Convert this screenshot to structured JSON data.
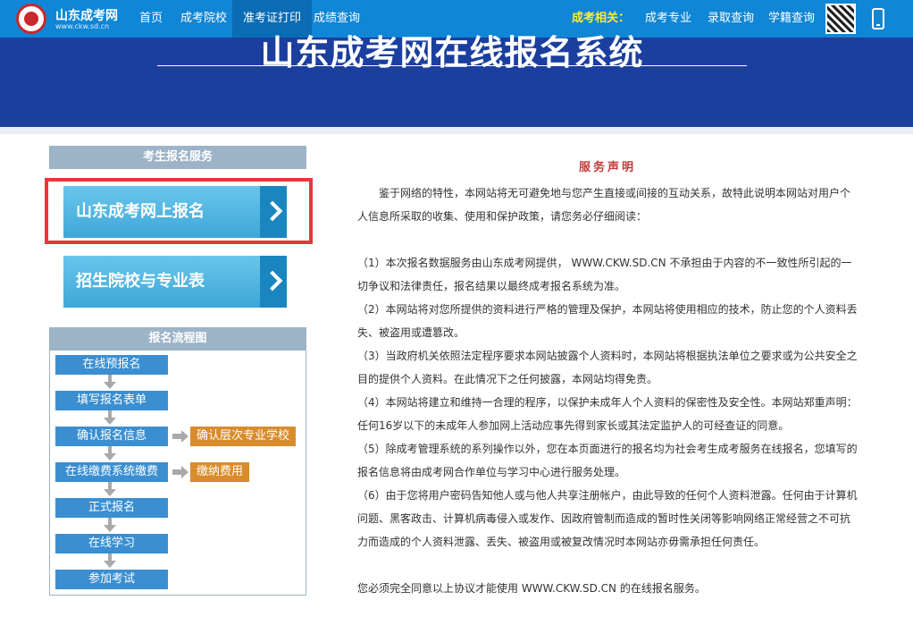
{
  "header": {
    "site_name": "山东成考网",
    "site_url": "www.ckw.sd.cn",
    "nav": [
      "首页",
      "成考院校",
      "准考证打印",
      "成绩查询"
    ],
    "related_label": "成考相关：",
    "related_nav": [
      "成考专业",
      "录取查询",
      "学籍查询"
    ]
  },
  "banner": {
    "title": "山东成考网在线报名系统"
  },
  "left": {
    "service_header": "考生报名服务",
    "btn_signup": "山东成考网上报名",
    "btn_schools": "招生院校与专业表",
    "flow_header": "报名流程图",
    "steps": [
      "在线预报名",
      "填写报名表单",
      "确认报名信息",
      "在线缴费系统缴费",
      "正式报名",
      "在线学习",
      "参加考试"
    ],
    "side_steps": [
      "确认层次专业学校",
      "缴纳费用"
    ]
  },
  "content": {
    "title": "服务声明",
    "intro_1": "鉴于网络的特性，本网站将无可避免地与您产生直接或间接的互动关系，故特此说明本网站对用户个",
    "intro_2": "人信息所采取的收集、使用和保护政策，请您务必仔细阅读：",
    "items": [
      [
        "（1）本次报名数据服务由山东成考网提供， WWW.CKW.SD.CN 不承担由于内容的不一致性所引起的一",
        "切争议和法律责任，报名结果以最终成考报名系统为准。"
      ],
      [
        "（2）本网站将对您所提供的资料进行严格的管理及保护，本网站将使用相应的技术，防止您的个人资料丢",
        "失、被盗用或遭篡改。"
      ],
      [
        "（3）当政府机关依照法定程序要求本网站披露个人资料时，本网站将根据执法单位之要求或为公共安全之",
        "目的提供个人资料。在此情况下之任何披露，本网站均得免责。"
      ],
      [
        "（4）本网站将建立和维持一合理的程序，以保护未成年人个人资料的保密性及安全性。本网站郑重声明：",
        "任何16岁以下的未成年人参加网上活动应事先得到家长或其法定监护人的可经查证的同意。"
      ],
      [
        "（5）除成考管理系统的系列操作以外，您在本页面进行的报名均为社会考生成考服务在线报名，您填写的",
        "报名信息将由成考网合作单位与学习中心进行服务处理。"
      ],
      [
        "（6）由于您将用户密码告知他人或与他人共享注册帐户，由此导致的任何个人资料泄露。任何由于计算机",
        "问题、黑客政击、计算机病毒侵入或发作、因政府管制而造成的暂时性关闭等影响网络正常经营之不可抗",
        "力而造成的个人资料泄露、丢失、被盗用或被复改情况时本网站亦毋需承担任何责任。"
      ]
    ],
    "agree": "您必须完全同意以上协议才能使用 WWW.CKW.SD.CN 的在线报名服务。"
  }
}
